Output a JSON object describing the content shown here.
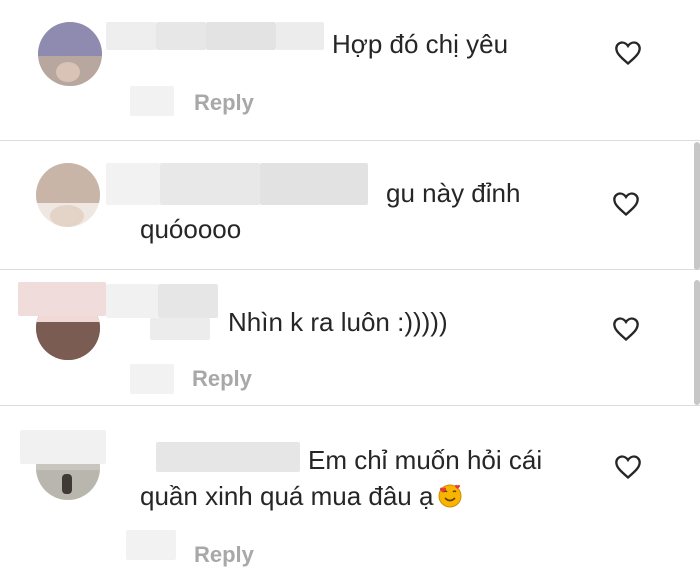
{
  "comments": [
    {
      "text": "Hợp đó chị yêu",
      "reply_label": "Reply",
      "icon": "heart-outline-icon"
    },
    {
      "text_line1": "gu này đỉnh",
      "text_line2": "quóoooo",
      "icon": "heart-outline-icon"
    },
    {
      "text": "Nhìn k ra luôn :)))))",
      "reply_label": "Reply",
      "icon": "heart-outline-icon"
    },
    {
      "text_line1": "Em chỉ muốn hỏi cái",
      "text_line2": "quần xinh quá mua đâu ạ",
      "emoji": "smiling-face-with-hearts",
      "reply_label": "Reply",
      "icon": "heart-outline-icon"
    }
  ],
  "colors": {
    "text": "#262626",
    "muted": "#a8a8a8",
    "divider": "#dcdcdc",
    "background": "#ffffff"
  }
}
